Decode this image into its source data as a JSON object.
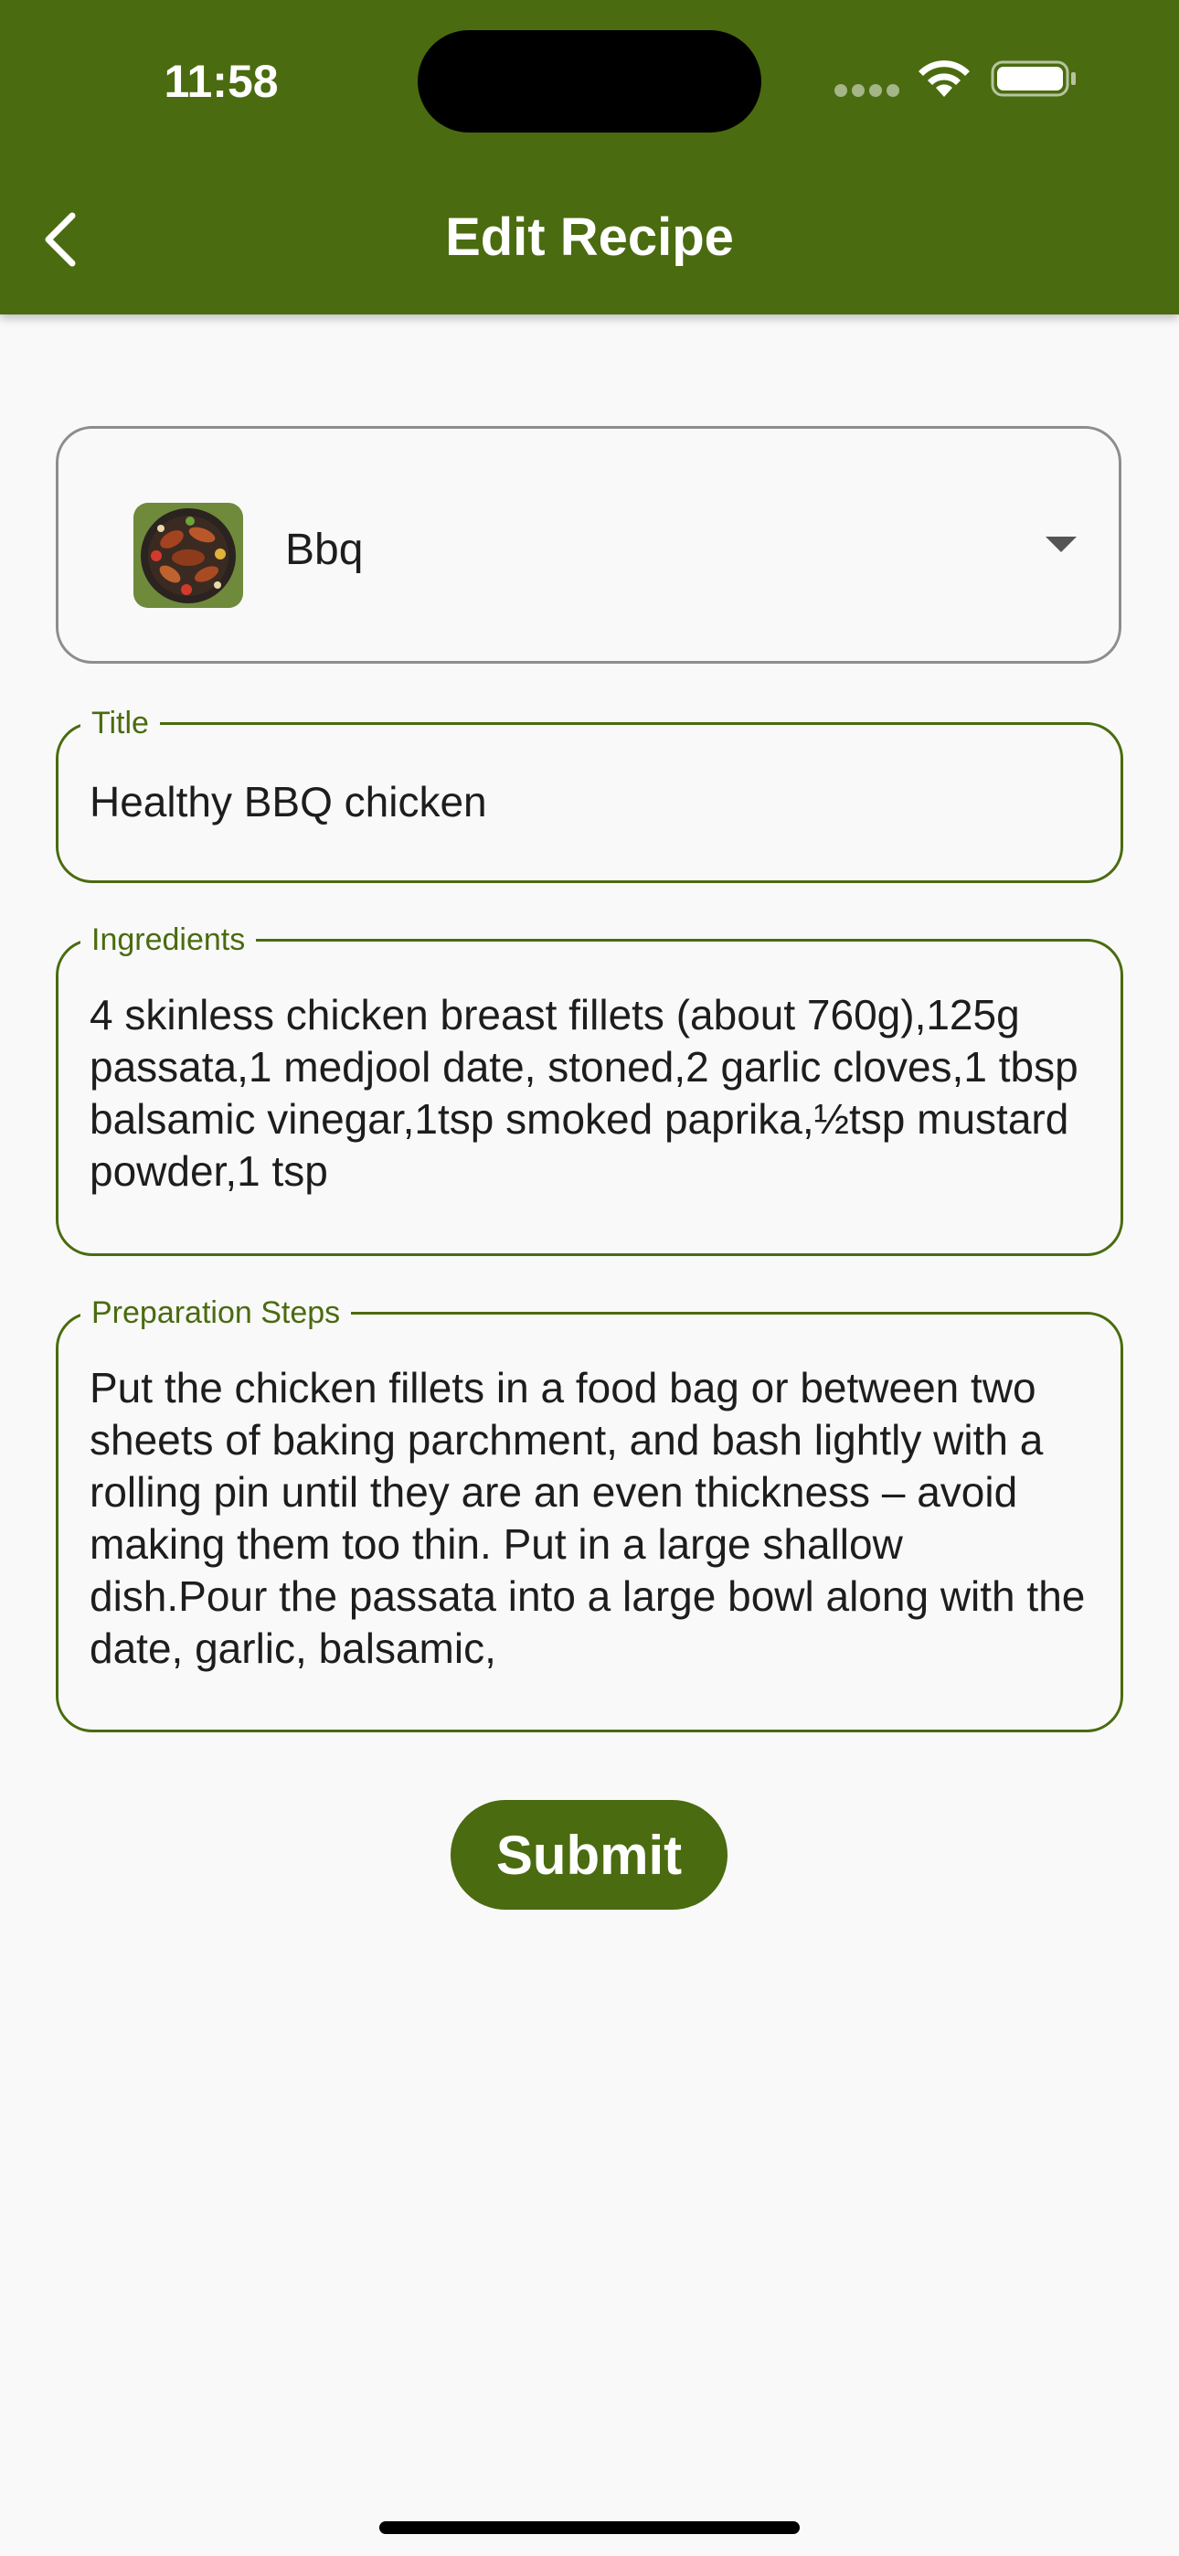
{
  "status_bar": {
    "time": "11:58",
    "signal_icon": "cellular-signal-icon",
    "wifi_icon": "wifi-icon",
    "battery_icon": "battery-icon"
  },
  "app_bar": {
    "title": "Edit Recipe",
    "back_icon": "chevron-left-icon",
    "background": "#4a6b0f"
  },
  "category_dropdown": {
    "selected_value": "Bbq",
    "image": "bbq-grill-thumbnail",
    "arrow_icon": "caret-down-icon"
  },
  "form": {
    "title": {
      "label": "Title",
      "value": "Healthy BBQ chicken"
    },
    "ingredients": {
      "label": "Ingredients",
      "value": "4 skinless chicken breast fillets (about 760g),125g passata,1 medjool date, stoned,2 garlic cloves,1 tbsp balsamic vinegar,1tsp smoked paprika,½tsp mustard powder,1 tsp"
    },
    "preparation_steps": {
      "label": "Preparation Steps",
      "value": "Put the chicken fillets in a food bag or between two sheets of baking parchment, and bash lightly with a rolling pin until they are an even thickness – avoid making them too thin. Put in a large shallow dish.Pour the passata into a large bowl along with the date, garlic, balsamic,"
    }
  },
  "submit": {
    "label": "Submit"
  },
  "colors": {
    "accent": "#4a6b0f",
    "background": "#f9f9f9",
    "text": "#1d1d1d"
  }
}
